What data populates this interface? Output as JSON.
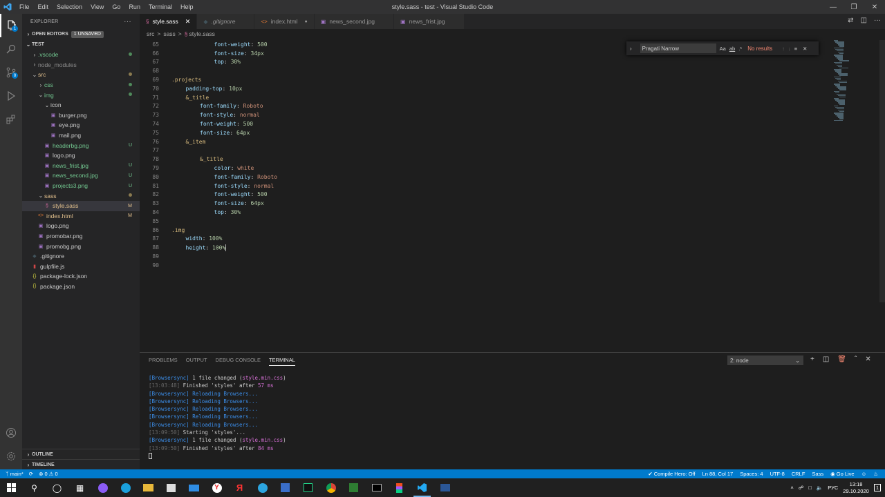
{
  "window": {
    "title": "style.sass - test - Visual Studio Code"
  },
  "menu": [
    "File",
    "Edit",
    "Selection",
    "View",
    "Go",
    "Run",
    "Terminal",
    "Help"
  ],
  "explorer": {
    "header": "EXPLORER",
    "open_editors": "OPEN EDITORS",
    "unsaved_badge": "1 UNSAVED",
    "root": "TEST",
    "outline": "OUTLINE",
    "timeline": "TIMELINE",
    "tree": [
      {
        "label": ".vscode",
        "indent": 1,
        "kind": "folder",
        "open": false,
        "status": "dot",
        "color": "#73c991"
      },
      {
        "label": "node_modules",
        "indent": 1,
        "kind": "folder",
        "open": false,
        "status": "",
        "color": "#8c8c8c"
      },
      {
        "label": "src",
        "indent": 1,
        "kind": "folder",
        "open": true,
        "status": "dot",
        "color": "#e2c08d"
      },
      {
        "label": "css",
        "indent": 2,
        "kind": "folder",
        "open": false,
        "status": "dot",
        "color": "#73c991"
      },
      {
        "label": "img",
        "indent": 2,
        "kind": "folder",
        "open": true,
        "status": "dot",
        "color": "#73c991"
      },
      {
        "label": "icon",
        "indent": 3,
        "kind": "folder",
        "open": true,
        "status": "",
        "color": "#ccc"
      },
      {
        "label": "burger.png",
        "indent": 4,
        "kind": "img",
        "status": "",
        "color": "#ccc"
      },
      {
        "label": "eye.png",
        "indent": 4,
        "kind": "img",
        "status": "",
        "color": "#ccc"
      },
      {
        "label": "mail.png",
        "indent": 4,
        "kind": "img",
        "status": "",
        "color": "#ccc"
      },
      {
        "label": "headerbg.png",
        "indent": 3,
        "kind": "img",
        "status": "U",
        "color": "#73c991"
      },
      {
        "label": "logo.png",
        "indent": 3,
        "kind": "img",
        "status": "",
        "color": "#ccc"
      },
      {
        "label": "news_frist.jpg",
        "indent": 3,
        "kind": "img",
        "status": "U",
        "color": "#73c991"
      },
      {
        "label": "news_second.jpg",
        "indent": 3,
        "kind": "img",
        "status": "U",
        "color": "#73c991"
      },
      {
        "label": "projects3.png",
        "indent": 3,
        "kind": "img",
        "status": "U",
        "color": "#73c991"
      },
      {
        "label": "sass",
        "indent": 2,
        "kind": "folder",
        "open": true,
        "status": "dot",
        "color": "#e2c08d"
      },
      {
        "label": "style.sass",
        "indent": 3,
        "kind": "sass",
        "status": "M",
        "color": "#e2c08d",
        "selected": true
      },
      {
        "label": "index.html",
        "indent": 2,
        "kind": "html",
        "status": "M",
        "color": "#e2c08d"
      },
      {
        "label": "logo.png",
        "indent": 2,
        "kind": "img",
        "status": "",
        "color": "#ccc"
      },
      {
        "label": "promobar.png",
        "indent": 2,
        "kind": "img",
        "status": "",
        "color": "#ccc"
      },
      {
        "label": "promobg.png",
        "indent": 2,
        "kind": "img",
        "status": "",
        "color": "#ccc"
      },
      {
        "label": ".gitignore",
        "indent": 1,
        "kind": "git",
        "status": "",
        "color": "#ccc"
      },
      {
        "label": "gulpfile.js",
        "indent": 1,
        "kind": "gulp",
        "status": "",
        "color": "#ccc"
      },
      {
        "label": "package-lock.json",
        "indent": 1,
        "kind": "json",
        "status": "",
        "color": "#ccc"
      },
      {
        "label": "package.json",
        "indent": 1,
        "kind": "json",
        "status": "",
        "color": "#ccc"
      }
    ]
  },
  "tabs": [
    {
      "label": "style.sass",
      "icon": "sass",
      "active": true
    },
    {
      "label": ".gitignore",
      "icon": "git",
      "active": false
    },
    {
      "label": "index.html",
      "icon": "html",
      "active": false,
      "dirty": true
    },
    {
      "label": "news_second.jpg",
      "icon": "img",
      "active": false
    },
    {
      "label": "news_frist.jpg",
      "icon": "img",
      "active": false
    }
  ],
  "breadcrumbs": [
    "src",
    ">",
    "sass",
    ">",
    "style.sass"
  ],
  "find": {
    "query": "Pragati Narrow",
    "case": "Aa",
    "word": "ab",
    "regex": ".*",
    "result": "No results"
  },
  "code": [
    {
      "n": "65",
      "indent": 3,
      "prop": "font-weight",
      "val": "500"
    },
    {
      "n": "66",
      "indent": 3,
      "prop": "font-size",
      "val": "34px"
    },
    {
      "n": "67",
      "indent": 3,
      "prop": "top",
      "val": "30%"
    },
    {
      "n": "68"
    },
    {
      "n": "69",
      "indent": 0,
      "sel": ".projects"
    },
    {
      "n": "70",
      "indent": 1,
      "prop": "padding-top",
      "val": "10px"
    },
    {
      "n": "71",
      "indent": 1,
      "sel": "&_title"
    },
    {
      "n": "72",
      "indent": 2,
      "prop": "font-family",
      "val": "Roboto"
    },
    {
      "n": "73",
      "indent": 2,
      "prop": "font-style",
      "val": "normal"
    },
    {
      "n": "74",
      "indent": 2,
      "prop": "font-weight",
      "val": "500"
    },
    {
      "n": "75",
      "indent": 2,
      "prop": "font-size",
      "val": "64px"
    },
    {
      "n": "76",
      "indent": 1,
      "sel": "&_item"
    },
    {
      "n": "77"
    },
    {
      "n": "78",
      "indent": 2,
      "sel": "&_title"
    },
    {
      "n": "79",
      "indent": 3,
      "prop": "color",
      "val": "white"
    },
    {
      "n": "80",
      "indent": 3,
      "prop": "font-family",
      "val": "Roboto"
    },
    {
      "n": "81",
      "indent": 3,
      "prop": "font-style",
      "val": "normal"
    },
    {
      "n": "82",
      "indent": 3,
      "prop": "font-weight",
      "val": "500"
    },
    {
      "n": "83",
      "indent": 3,
      "prop": "font-size",
      "val": "64px"
    },
    {
      "n": "84",
      "indent": 3,
      "prop": "top",
      "val": "30%"
    },
    {
      "n": "85"
    },
    {
      "n": "86",
      "indent": 0,
      "sel": ".img"
    },
    {
      "n": "87",
      "indent": 1,
      "prop": "width",
      "val": "100%"
    },
    {
      "n": "88",
      "indent": 1,
      "prop": "height",
      "val": "100%",
      "cursor": true
    },
    {
      "n": "89"
    },
    {
      "n": "90"
    }
  ],
  "panel": {
    "tabs": [
      "PROBLEMS",
      "OUTPUT",
      "DEBUG CONSOLE",
      "TERMINAL"
    ],
    "active": "TERMINAL",
    "terminal_select": "2: node",
    "lines": [
      [
        [
          "bs",
          "[Browsersync]"
        ],
        [
          "tt",
          " 1 file changed ("
        ],
        [
          "mag",
          "style.min.css"
        ],
        [
          "tt",
          ")"
        ]
      ],
      [
        [
          "tm",
          "[13:03:48]"
        ],
        [
          "tt",
          " Finished 'styles' after "
        ],
        [
          "mag",
          "57 ms"
        ]
      ],
      [
        [
          "bs",
          "[Browsersync]"
        ],
        [
          "bs",
          " Reloading Browsers..."
        ]
      ],
      [
        [
          "bs",
          "[Browsersync]"
        ],
        [
          "bs",
          " Reloading Browsers..."
        ]
      ],
      [
        [
          "bs",
          "[Browsersync]"
        ],
        [
          "bs",
          " Reloading Browsers..."
        ]
      ],
      [
        [
          "bs",
          "[Browsersync]"
        ],
        [
          "bs",
          " Reloading Browsers..."
        ]
      ],
      [
        [
          "bs",
          "[Browsersync]"
        ],
        [
          "bs",
          " Reloading Browsers..."
        ]
      ],
      [
        [
          "tm",
          "[13:09:50]"
        ],
        [
          "tt",
          " Starting 'styles'..."
        ]
      ],
      [
        [
          "bs",
          "[Browsersync]"
        ],
        [
          "tt",
          " 1 file changed ("
        ],
        [
          "mag",
          "style.min.css"
        ],
        [
          "tt",
          ")"
        ]
      ],
      [
        [
          "tm",
          "[13:09:50]"
        ],
        [
          "tt",
          " Finished 'styles' after "
        ],
        [
          "mag",
          "84 ms"
        ]
      ]
    ]
  },
  "status": {
    "branch": "main*",
    "errors": "0",
    "warnings": "0",
    "compile": "Compile Hero: Off",
    "position": "Ln 88, Col 17",
    "spaces": "Spaces: 4",
    "encoding": "UTF-8",
    "eol": "CRLF",
    "lang": "Sass",
    "live": "Go Live"
  },
  "taskbar": {
    "lang": "РУС",
    "time": "13:18",
    "date": "29.10.2020",
    "notif": "1"
  }
}
